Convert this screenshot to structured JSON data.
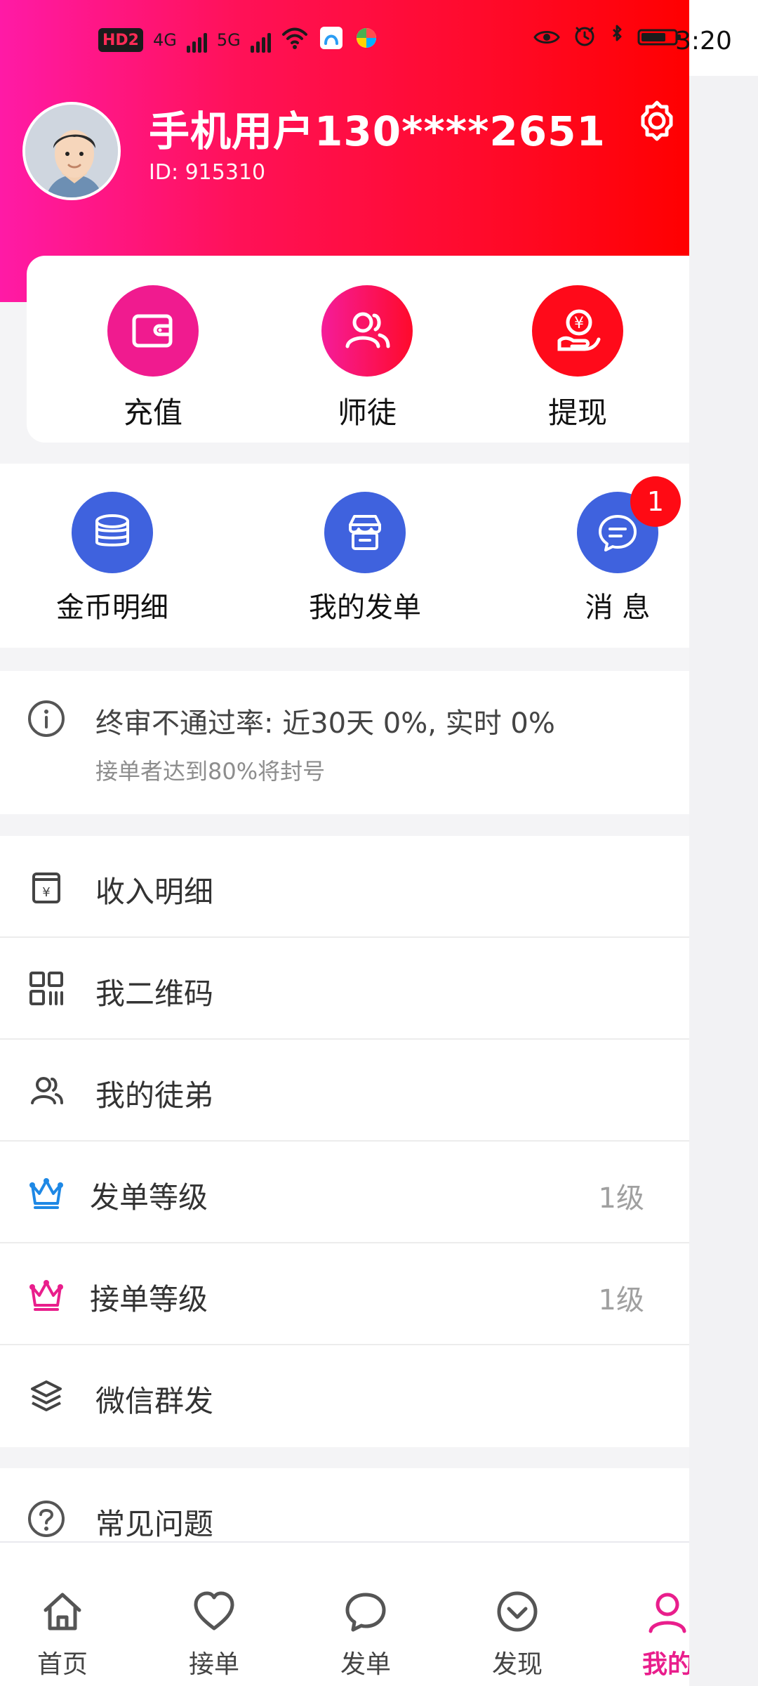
{
  "status_bar": {
    "left_badges": [
      "HD2",
      "4G",
      "5G"
    ],
    "time": "3:20"
  },
  "profile": {
    "name": "手机用户130****2651",
    "id_text": "ID: 915310"
  },
  "top_actions": [
    {
      "label": "充值",
      "icon": "wallet-icon",
      "color": "#f01b8f"
    },
    {
      "label": "师徒",
      "icon": "people-icon",
      "color": "#ff1b73"
    },
    {
      "label": "提现",
      "icon": "withdraw-icon",
      "color": "#ff0a1a"
    }
  ],
  "quick_items": [
    {
      "label": "金币明细",
      "icon": "coins-icon"
    },
    {
      "label": "我的发单",
      "icon": "store-icon"
    },
    {
      "label": "消 息",
      "icon": "message-icon",
      "badge": "1"
    }
  ],
  "notice": {
    "title": "终审不通过率: 近30天 0%, 实时 0%",
    "subtitle": "接单者达到80%将封号"
  },
  "menu": [
    {
      "label": "收入明细",
      "icon": "income-icon"
    },
    {
      "label": "我二维码",
      "icon": "qr-code-icon"
    },
    {
      "label": "我的徒弟",
      "icon": "people-icon"
    },
    {
      "label": "发单等级",
      "icon": "crown-blue-icon",
      "value": "1级"
    },
    {
      "label": "接单等级",
      "icon": "crown-pink-icon",
      "value": "1级"
    },
    {
      "label": "微信群发",
      "icon": "layers-icon"
    }
  ],
  "faq": {
    "label": "常见问题",
    "icon": "help-icon"
  },
  "bottom_nav": [
    {
      "label": "首页",
      "icon": "home-icon"
    },
    {
      "label": "接单",
      "icon": "heart-icon"
    },
    {
      "label": "发单",
      "icon": "chat-icon"
    },
    {
      "label": "发现",
      "icon": "discover-icon"
    },
    {
      "label": "我的",
      "icon": "user-icon",
      "active": true
    }
  ],
  "colors": {
    "header_gradient": [
      "#ff1aa6",
      "#ff0000"
    ],
    "blue": "#3f62de",
    "active_tab": "#e91e8c"
  }
}
